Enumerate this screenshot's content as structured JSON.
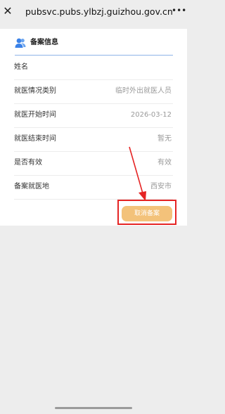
{
  "browser": {
    "close_glyph": "✕",
    "url": "pubsvc.pubs.ylbzj.guizhou.gov.cn",
    "more_glyph": "•••"
  },
  "card": {
    "icon": "person-icon",
    "title": "备案信息",
    "accent_color": "#3b82e8",
    "rows": [
      {
        "label": "姓名",
        "value": ""
      },
      {
        "label": "就医情况类别",
        "value": "临时外出就医人员"
      },
      {
        "label": "就医开始时间",
        "value": "2026-03-12"
      },
      {
        "label": "就医结束时间",
        "value": "暂无"
      },
      {
        "label": "是否有效",
        "value": "有效"
      },
      {
        "label": "备案就医地",
        "value": "西安市"
      }
    ]
  },
  "actions": {
    "cancel_label": "取消备案",
    "cancel_color": "#f3c27a"
  },
  "annotation": {
    "color": "#e52424"
  }
}
